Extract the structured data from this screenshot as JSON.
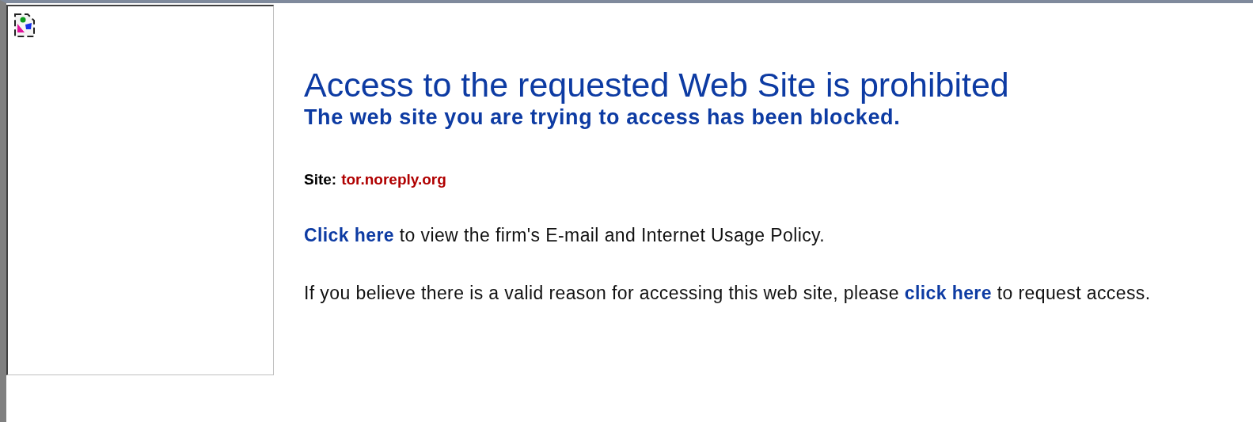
{
  "image_placeholder": {
    "broken": true
  },
  "title": "Access to the requested Web Site is prohibited",
  "subtitle": "The web site you are trying to access has been blocked.",
  "site": {
    "label": "Site:",
    "value": "tor.noreply.org"
  },
  "paragraphs": [
    {
      "link": "Click here",
      "after": " to view the firm's E-mail and Internet Usage Policy."
    },
    {
      "before": "If you believe there is a valid reason for accessing this web site, please ",
      "link": "click here",
      "after": " to request access."
    }
  ]
}
